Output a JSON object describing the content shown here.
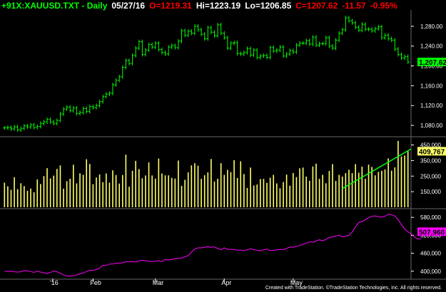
{
  "header": {
    "symbol": "+91X:XAUUSD.TXT - Daily",
    "date": "05/27/16",
    "open": "O=1219.31",
    "high": "Hi=1223.19",
    "low": "Lo=1206.85",
    "close": "C=1207.62",
    "change": "-11.57",
    "change_pct": "-0.95%"
  },
  "footer": {
    "credit": "Created with TradeStation. ©TradeStation Technologies, Inc. All rights reserved."
  },
  "colors": {
    "background": "#000000",
    "price": "#00ff00",
    "volume": "#ffff66",
    "indicator": "#ff00ff",
    "trendline": "#00ff00",
    "grid": "#666666",
    "text": "#ffffff",
    "down": "#ff0000"
  },
  "chart_data": [
    {
      "type": "ohlc",
      "panel": "price",
      "y_ticks": [
        1080,
        1120,
        1160,
        1200,
        1240,
        1280
      ],
      "y_tick_labels": [
        "1,080.00",
        "1,120.00",
        "1,160.00",
        "1,200.00",
        "1,240.00",
        "1,280.00"
      ],
      "ylim": [
        1060,
        1310
      ],
      "last_label": "1,207.62",
      "closes": [
        1075,
        1076,
        1073,
        1077,
        1071,
        1074,
        1079,
        1077,
        1081,
        1076,
        1078,
        1084,
        1087,
        1092,
        1087,
        1084,
        1090,
        1103,
        1113,
        1117,
        1110,
        1115,
        1104,
        1106,
        1114,
        1108,
        1118,
        1116,
        1120,
        1128,
        1138,
        1143,
        1145,
        1162,
        1171,
        1178,
        1197,
        1211,
        1205,
        1221,
        1236,
        1249,
        1223,
        1232,
        1243,
        1238,
        1246,
        1233,
        1227,
        1224,
        1238,
        1241,
        1237,
        1250,
        1271,
        1262,
        1270,
        1266,
        1280,
        1273,
        1264,
        1255,
        1277,
        1268,
        1261,
        1283,
        1266,
        1257,
        1236,
        1246,
        1247,
        1225,
        1224,
        1227,
        1235,
        1222,
        1232,
        1217,
        1220,
        1221,
        1217,
        1237,
        1230,
        1232,
        1238,
        1220,
        1224,
        1231,
        1228,
        1242,
        1246,
        1246,
        1251,
        1244,
        1258,
        1242,
        1245,
        1245,
        1257,
        1240,
        1236,
        1252,
        1266,
        1273,
        1297,
        1291,
        1287,
        1278,
        1272,
        1284,
        1274,
        1274,
        1271,
        1275,
        1279,
        1257,
        1262,
        1255,
        1252,
        1234,
        1223,
        1216,
        1219,
        1208
      ]
    },
    {
      "type": "bar",
      "panel": "volume",
      "y_ticks": [
        150000,
        250000,
        350000,
        450000
      ],
      "y_tick_labels": [
        "150,000",
        "250,000",
        "350,000",
        "450,000"
      ],
      "ylim": [
        50000,
        480000
      ],
      "last_label": "409,767",
      "values": [
        208000,
        185000,
        162000,
        243000,
        166000,
        204000,
        186000,
        156000,
        170000,
        146000,
        229000,
        199000,
        250000,
        301000,
        235000,
        253000,
        296000,
        319000,
        169000,
        217000,
        233000,
        323000,
        203000,
        268000,
        258000,
        358000,
        328000,
        198000,
        241000,
        261000,
        211000,
        267000,
        208000,
        287000,
        257000,
        202000,
        257000,
        388000,
        182000,
        284000,
        348000,
        295000,
        236000,
        254000,
        338000,
        254000,
        234000,
        363000,
        267000,
        255000,
        255000,
        239000,
        234000,
        350000,
        187000,
        226000,
        274000,
        319000,
        333000,
        317000,
        232000,
        256000,
        274000,
        360000,
        215000,
        233000,
        333000,
        258000,
        290000,
        276000,
        352000,
        238000,
        345000,
        263000,
        174000,
        305000,
        190000,
        196000,
        231000,
        232000,
        207000,
        240000,
        258000,
        203000,
        172000,
        212000,
        260000,
        188000,
        270000,
        244000,
        300000,
        305000,
        247000,
        220000,
        312000,
        330000,
        232000,
        258000,
        204000,
        283000,
        327000,
        219000,
        258000,
        247000,
        269000,
        291000,
        269000,
        327000,
        272000,
        311000,
        233000,
        324000,
        309000,
        255000,
        277000,
        284000,
        293000,
        364000,
        285000,
        306000,
        476000,
        376000,
        382000,
        409767
      ]
    },
    {
      "type": "line",
      "panel": "indicator",
      "y_ticks": [
        400000,
        460000,
        520000,
        580000
      ],
      "y_tick_labels": [
        "400,000",
        "460,000",
        "520,000",
        "580,000"
      ],
      "ylim": [
        378000,
        602000
      ],
      "last_label": "507,960",
      "x_labels": [
        "'16",
        "Feb",
        "Mar",
        "Apr",
        "May"
      ],
      "values": [
        400000,
        399000,
        400000,
        398000,
        397000,
        398000,
        402000,
        401000,
        399000,
        396000,
        400000,
        397000,
        395000,
        392000,
        396000,
        400000,
        398000,
        393000,
        388000,
        384000,
        384000,
        385000,
        387000,
        392000,
        394000,
        399000,
        403000,
        402000,
        406000,
        410000,
        420000,
        419000,
        424000,
        424000,
        427000,
        427000,
        428000,
        432000,
        431000,
        432000,
        431000,
        434000,
        437000,
        435000,
        433000,
        432000,
        433000,
        435000,
        432000,
        439000,
        438000,
        439000,
        442000,
        443000,
        444000,
        448000,
        452000,
        464000,
        474000,
        478000,
        478000,
        480000,
        482000,
        480000,
        481000,
        476000,
        472000,
        478000,
        473000,
        473000,
        473000,
        470000,
        471000,
        468000,
        472000,
        475000,
        472000,
        470000,
        468000,
        472000,
        474000,
        469000,
        470000,
        471000,
        473000,
        472000,
        476000,
        481000,
        480000,
        483000,
        486000,
        490000,
        494000,
        498000,
        497000,
        501000,
        505000,
        502000,
        506000,
        513000,
        515000,
        518000,
        520000,
        515000,
        517000,
        520000,
        531000,
        548000,
        563000,
        566000,
        572000,
        579000,
        584000,
        585000,
        582000,
        581000,
        584000,
        590000,
        589000,
        585000,
        572000,
        556000,
        541000,
        532000,
        525000,
        514000,
        508000,
        507960
      ]
    }
  ]
}
